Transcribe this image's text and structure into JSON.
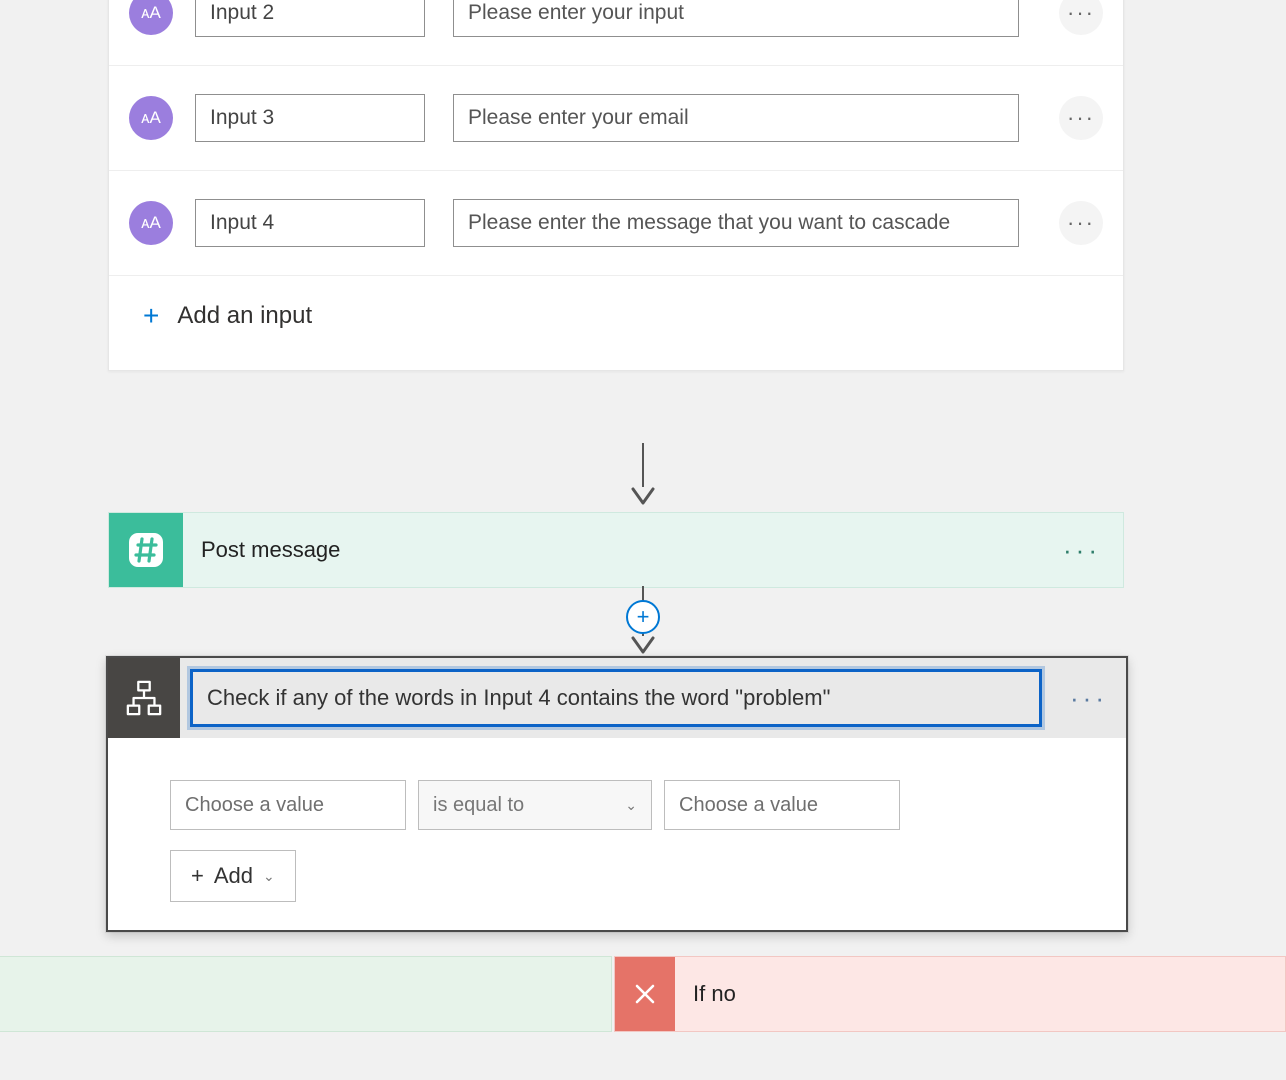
{
  "trigger": {
    "inputs": [
      {
        "badge": "ᴀA",
        "name": "Input 2",
        "placeholder": "Please enter your input"
      },
      {
        "badge": "ᴀA",
        "name": "Input 3",
        "placeholder": "Please enter your email"
      },
      {
        "badge": "ᴀA",
        "name": "Input 4",
        "placeholder": "Please enter the message that you want to cascade"
      }
    ],
    "add_label": "Add an input"
  },
  "post_message": {
    "title": "Post message"
  },
  "condition": {
    "title": "Check if any of the words in Input 4 contains the word \"problem\"",
    "left_placeholder": "Choose a value",
    "operator": "is equal to",
    "right_placeholder": "Choose a value",
    "add_label": "Add"
  },
  "branches": {
    "if_no": "If no"
  },
  "colors": {
    "accent_blue": "#0c63c7",
    "slack_green": "#3bbd9b",
    "danger": "#e57368",
    "badge_purple": "#9b7ede"
  }
}
